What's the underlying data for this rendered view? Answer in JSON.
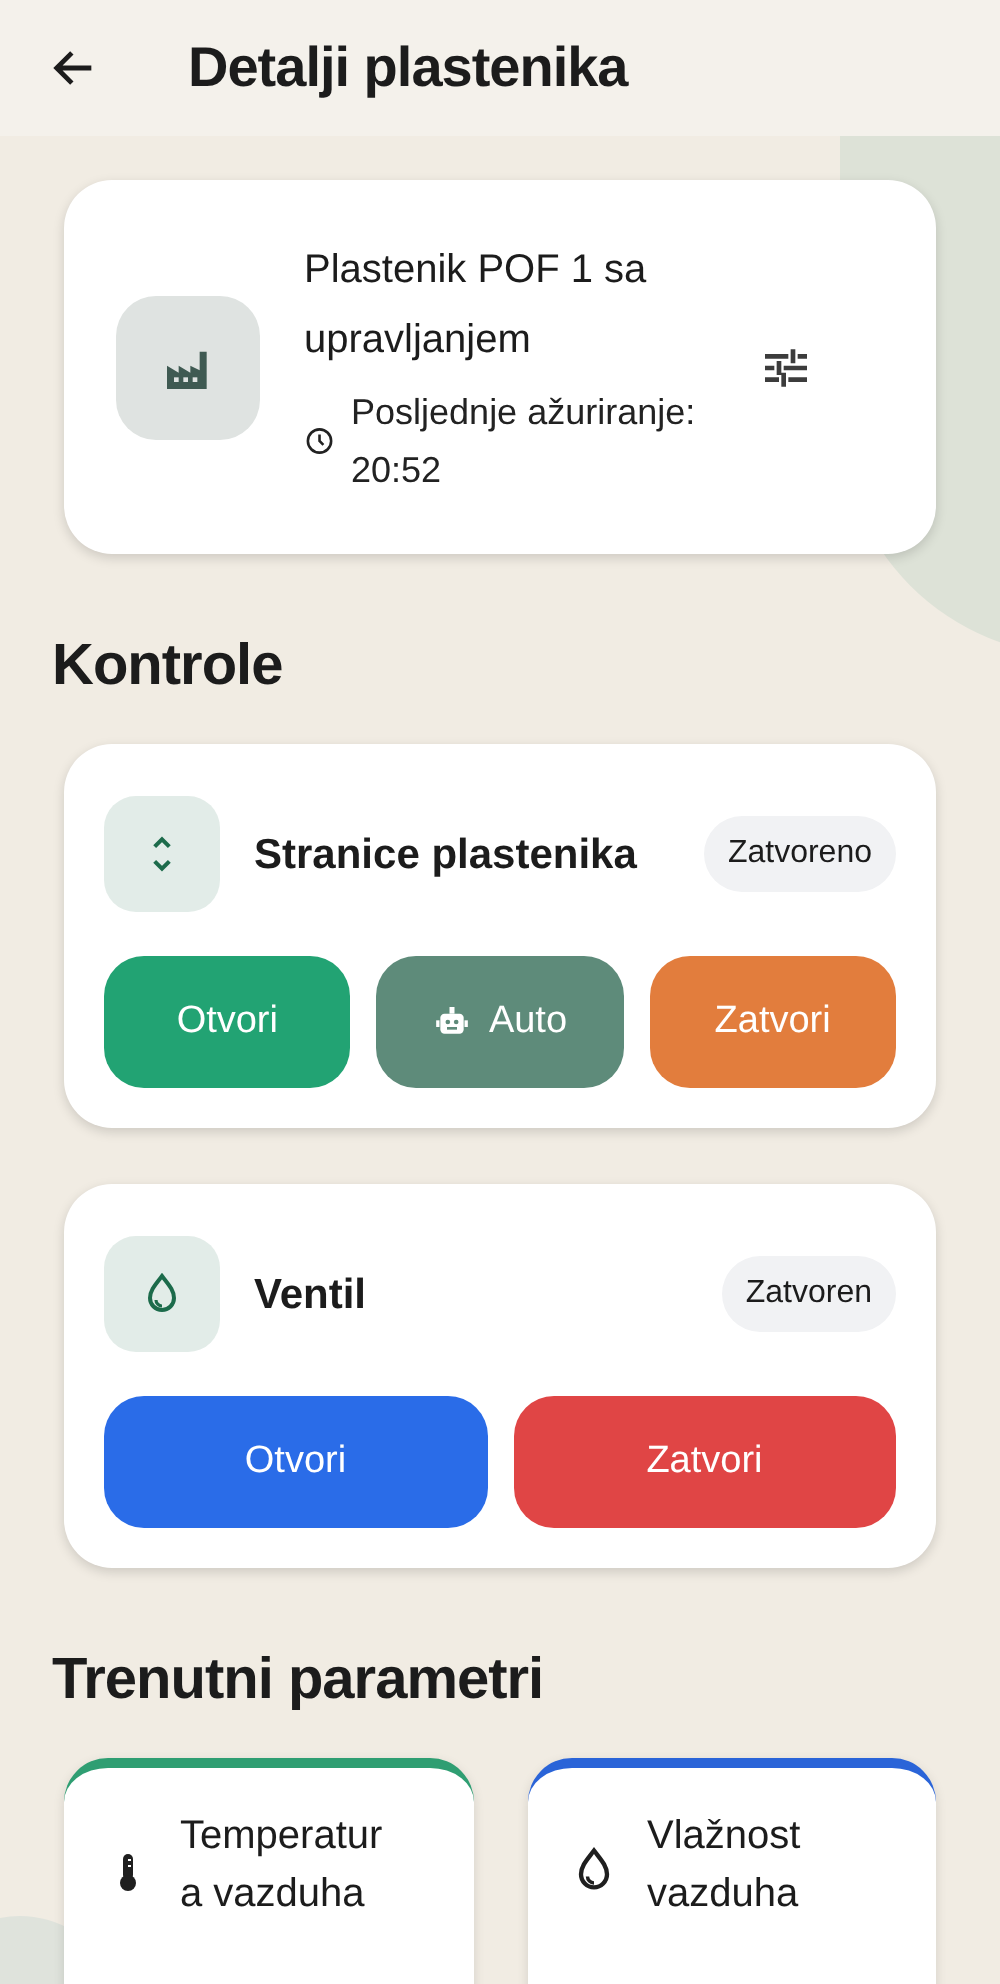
{
  "header": {
    "title": "Detalji plastenika"
  },
  "greenhouse": {
    "name": "Plastenik POF 1 sa upravljanjem",
    "updated": "Posljednje ažuriranje: 20:52"
  },
  "controls_title": "Kontrole",
  "devices": [
    {
      "kind": "sides",
      "name": "Stranice plastenika",
      "status": "Zatvoreno",
      "buttons": [
        {
          "label": "Otvori",
          "color": "#22a373",
          "icon": false
        },
        {
          "label": "Auto",
          "color": "#5e8b7a",
          "icon": true
        },
        {
          "label": "Zatvori",
          "color": "#e27d3d",
          "icon": false
        }
      ]
    },
    {
      "kind": "valve",
      "name": "Ventil",
      "status": "Zatvoren",
      "buttons": [
        {
          "label": "Otvori",
          "color": "#2a6ce8",
          "icon": false
        },
        {
          "label": "Zatvori",
          "color": "#e04545",
          "icon": false
        }
      ]
    }
  ],
  "params_title": "Trenutni parametri",
  "params": [
    {
      "kind": "temperature",
      "label": "Temperatura vazduha",
      "color": "#2f9e72"
    },
    {
      "kind": "humidity",
      "label": "Vlažnost vazduha",
      "color": "#2a64d8"
    }
  ]
}
